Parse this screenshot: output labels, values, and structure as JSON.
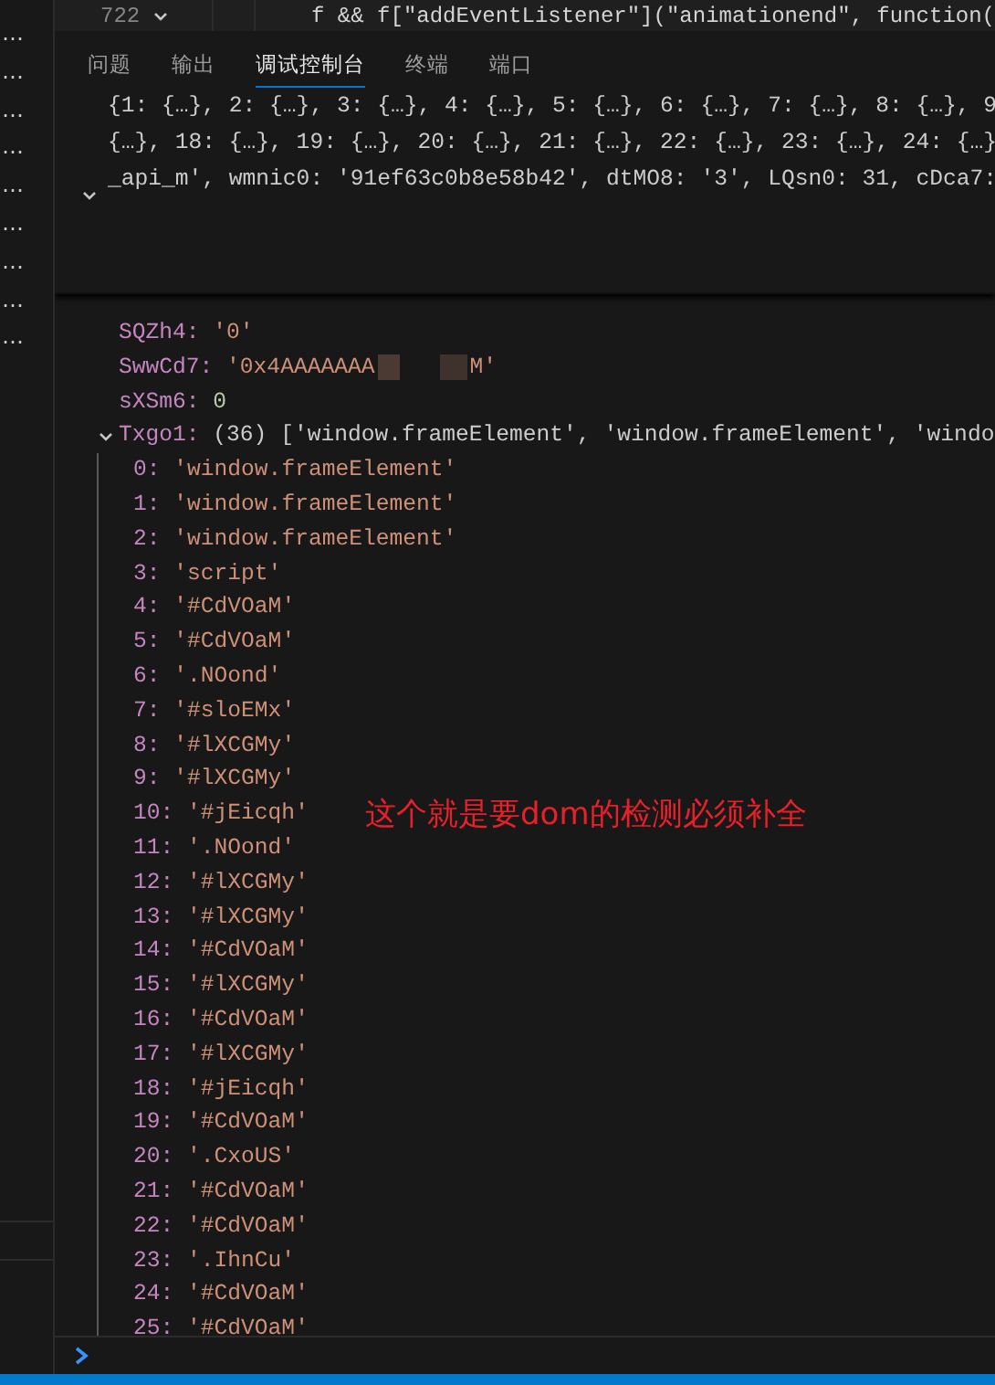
{
  "sidebar": {
    "items": [
      "…",
      "…",
      "…",
      "…",
      "…",
      "…",
      "…",
      "…",
      "…"
    ]
  },
  "editor": {
    "line_number": "722",
    "code": "f && f[\"addEventListener\"](\"animationend\", function("
  },
  "panel_tabs": [
    {
      "label": "问题",
      "selected": false
    },
    {
      "label": "输出",
      "selected": false
    },
    {
      "label": "调试控制台",
      "selected": true
    },
    {
      "label": "终端",
      "selected": false
    },
    {
      "label": "端口",
      "selected": false
    }
  ],
  "console": {
    "summary_lines": [
      {
        "text": "{1: {…}, 2: {…}, 3: {…}, 4: {…}, 5: {…}, 6: {…}, 7: {…}, 8: {…}, 9",
        "expanded": false
      },
      {
        "text": "{…}, 18: {…}, 19: {…}, 20: {…}, 21: {…}, 22: {…}, 23: {…}, 24: {…}",
        "expanded": false
      },
      {
        "text": "_api_m', wmnic0: '91ef63c0b8e58b42', dtMO8: '3', LQsn0: 31, cDca7:",
        "expanded": true
      }
    ],
    "properties": [
      {
        "key": "SQZh4:",
        "value": "'0'",
        "kind": "string"
      },
      {
        "key": "SwwCd7:",
        "value": "'0x4AAAAAAA",
        "value_tail": "M'",
        "kind": "redacted"
      },
      {
        "key": "sXSm6:",
        "value": "0",
        "kind": "number"
      }
    ],
    "array": {
      "key": "Txgo1:",
      "length": "(36)",
      "preview": "['window.frameElement', 'window.frameElement', 'windo",
      "expanded": true,
      "items": [
        {
          "index": "0:",
          "value": "'window.frameElement'"
        },
        {
          "index": "1:",
          "value": "'window.frameElement'"
        },
        {
          "index": "2:",
          "value": "'window.frameElement'"
        },
        {
          "index": "3:",
          "value": "'script'"
        },
        {
          "index": "4:",
          "value": "'#CdVOaM'"
        },
        {
          "index": "5:",
          "value": "'#CdVOaM'"
        },
        {
          "index": "6:",
          "value": "'.NOond'"
        },
        {
          "index": "7:",
          "value": "'#sloEMx'"
        },
        {
          "index": "8:",
          "value": "'#lXCGMy'"
        },
        {
          "index": "9:",
          "value": "'#lXCGMy'"
        },
        {
          "index": "10:",
          "value": "'#jEicqh'"
        },
        {
          "index": "11:",
          "value": "'.NOond'"
        },
        {
          "index": "12:",
          "value": "'#lXCGMy'"
        },
        {
          "index": "13:",
          "value": "'#lXCGMy'"
        },
        {
          "index": "14:",
          "value": "'#CdVOaM'"
        },
        {
          "index": "15:",
          "value": "'#lXCGMy'"
        },
        {
          "index": "16:",
          "value": "'#CdVOaM'"
        },
        {
          "index": "17:",
          "value": "'#lXCGMy'"
        },
        {
          "index": "18:",
          "value": "'#jEicqh'"
        },
        {
          "index": "19:",
          "value": "'#CdVOaM'"
        },
        {
          "index": "20:",
          "value": "'.CxoUS'"
        },
        {
          "index": "21:",
          "value": "'#CdVOaM'"
        },
        {
          "index": "22:",
          "value": "'#CdVOaM'"
        },
        {
          "index": "23:",
          "value": "'.IhnCu'"
        },
        {
          "index": "24:",
          "value": "'#CdVOaM'"
        },
        {
          "index": "25:",
          "value": "'#CdVOaM'"
        }
      ]
    }
  },
  "annotation": {
    "text": "这个就是要dom的检测必须补全"
  }
}
